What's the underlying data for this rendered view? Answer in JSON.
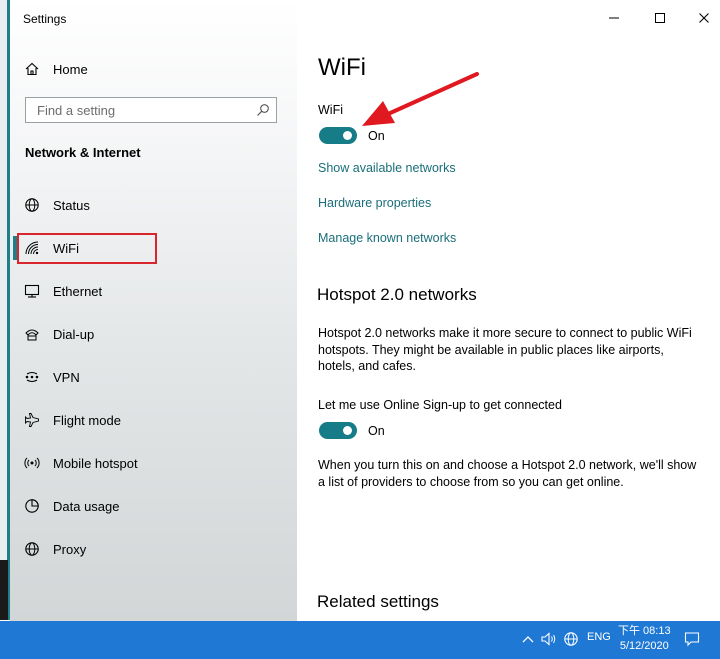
{
  "window": {
    "title": "Settings"
  },
  "sidebar": {
    "home_label": "Home",
    "search_placeholder": "Find a setting",
    "section_header": "Network & Internet",
    "items": [
      {
        "label": "Status",
        "icon": "globe-icon"
      },
      {
        "label": "WiFi",
        "icon": "wifi-icon",
        "selected": true
      },
      {
        "label": "Ethernet",
        "icon": "ethernet-icon"
      },
      {
        "label": "Dial-up",
        "icon": "dial-up-icon"
      },
      {
        "label": "VPN",
        "icon": "vpn-icon"
      },
      {
        "label": "Flight mode",
        "icon": "airplane-icon"
      },
      {
        "label": "Mobile hotspot",
        "icon": "hotspot-icon"
      },
      {
        "label": "Data usage",
        "icon": "data-usage-icon"
      },
      {
        "label": "Proxy",
        "icon": "globe-icon"
      }
    ]
  },
  "main": {
    "title": "WiFi",
    "wifi_label": "WiFi",
    "wifi_toggle_state": "On",
    "links": {
      "show_networks": "Show available networks",
      "hardware": "Hardware properties",
      "manage_known": "Manage known networks"
    },
    "hotspot": {
      "heading": "Hotspot 2.0 networks",
      "description_lines": [
        "Hotspot 2.0 networks make it more secure to connect to public WiFi",
        "hotspots. They might be available in public places like airports,",
        "hotels, and cafes."
      ],
      "signup_label": "Let me use Online Sign-up to get connected",
      "signup_toggle_state": "On",
      "info_lines": [
        "When you turn this on and choose a Hotspot 2.0 network, we'll show",
        "a list of providers to choose from so you can get online."
      ]
    },
    "related_heading": "Related settings"
  },
  "taskbar": {
    "language": "ENG",
    "time": "下午 08:13",
    "date": "5/12/2020"
  },
  "colors": {
    "accent": "#167c88",
    "link": "#1a6f7a",
    "annotation_red": "#d9262c",
    "taskbar": "#1f78d4"
  }
}
